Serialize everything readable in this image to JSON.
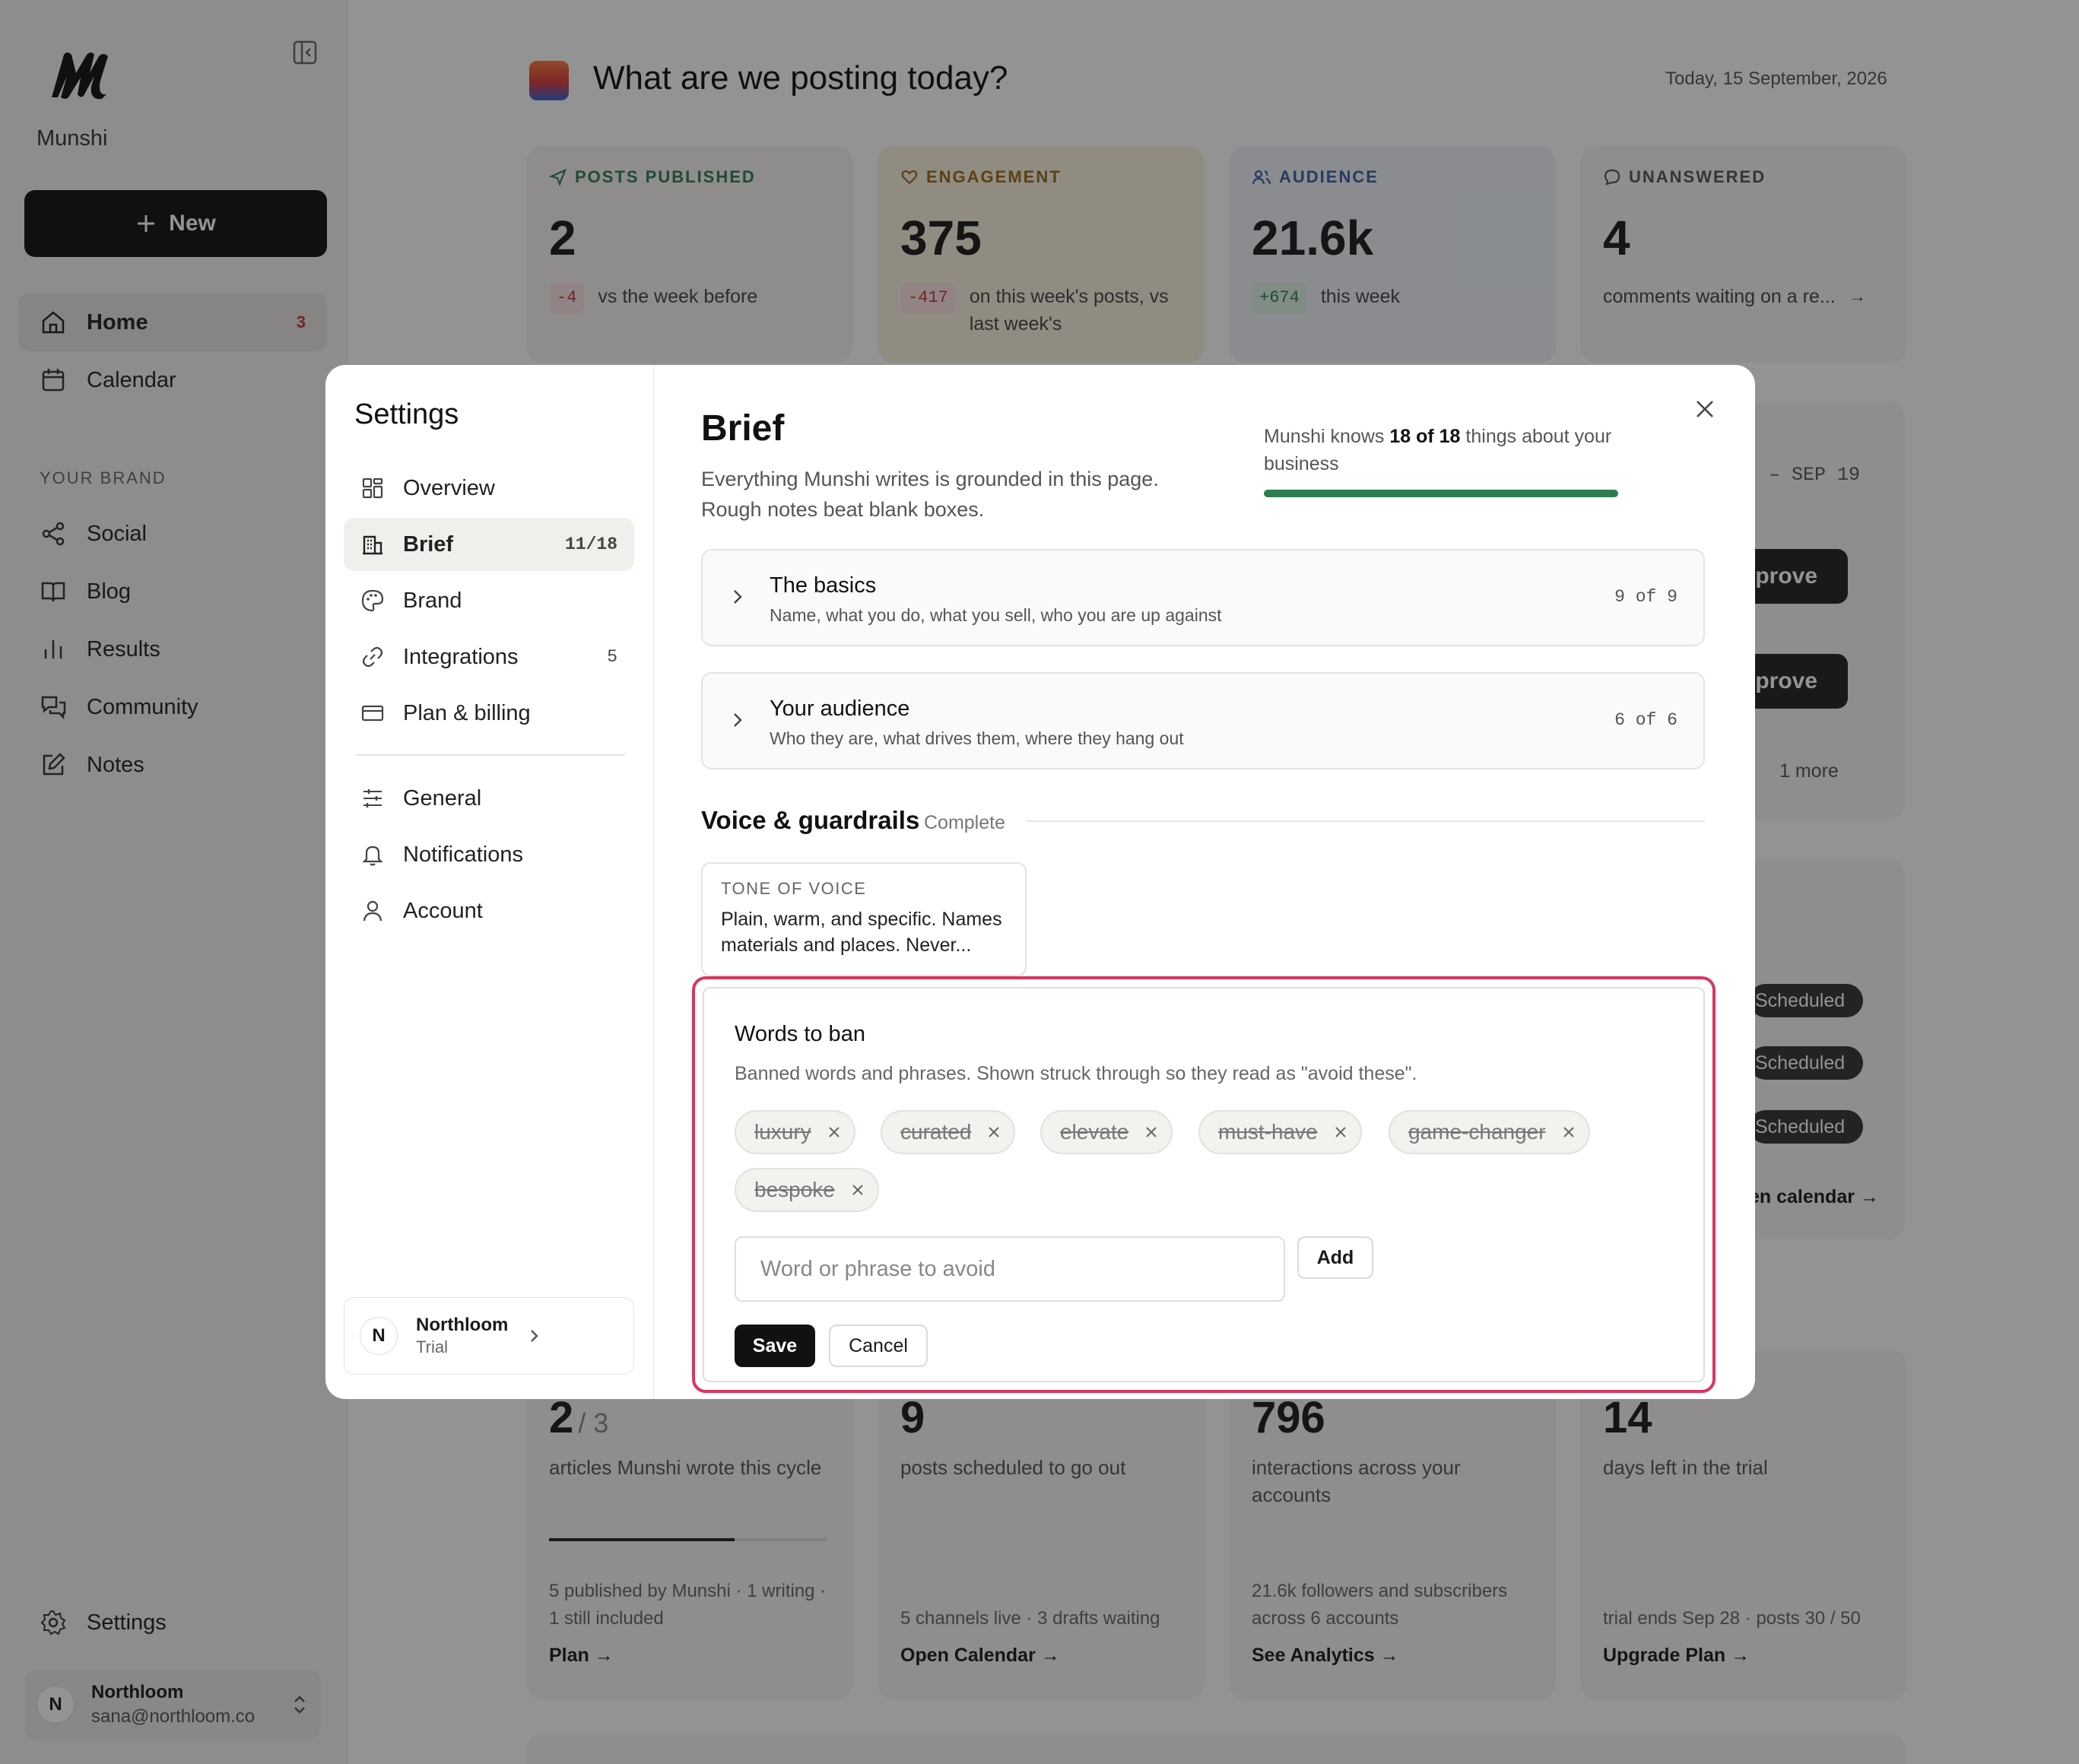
{
  "sidebar": {
    "brand": "Munshi",
    "new_label": "New",
    "items": [
      {
        "label": "Home",
        "count": "3"
      },
      {
        "label": "Calendar"
      }
    ],
    "section_label": "YOUR BRAND",
    "brand_items": [
      {
        "label": "Social"
      },
      {
        "label": "Blog"
      },
      {
        "label": "Results"
      },
      {
        "label": "Community"
      },
      {
        "label": "Notes"
      }
    ],
    "settings_label": "Settings",
    "user": {
      "initial": "N",
      "name": "Northloom",
      "email": "sana@northloom.co"
    }
  },
  "header": {
    "title": "What are we posting today?",
    "date": "Today, 15 September, 2026"
  },
  "stats": [
    {
      "label": "POSTS PUBLISHED",
      "value": "2",
      "delta": "-4",
      "note": "vs the week before",
      "color": "#2f7d4f"
    },
    {
      "label": "ENGAGEMENT",
      "value": "375",
      "delta": "-417",
      "note": "on this week's posts, vs last week's",
      "color": "#9a6a16"
    },
    {
      "label": "AUDIENCE",
      "value": "21.6k",
      "delta": "+674",
      "note": "this week",
      "color": "#3a5f9e"
    },
    {
      "label": "UNANSWERED",
      "value": "4",
      "note": "comments waiting on a re...",
      "color": "#555555"
    }
  ],
  "right_panel": {
    "date_range": "– SEP 19",
    "approve_label": "pprove",
    "more": "1 more",
    "scheduled_label": "Scheduled",
    "calendar_link": "en calendar →"
  },
  "bottom_cards": [
    {
      "value": "2",
      "value_suffix": "/ 3",
      "sub": "articles Munshi wrote this cycle",
      "progress": 0.667,
      "foot": "5 published by Munshi · 1 writing · 1 still included",
      "link": "Plan →"
    },
    {
      "value": "9",
      "sub": "posts scheduled to go out",
      "foot": "5 channels live · 3 drafts waiting",
      "link": "Open Calendar →"
    },
    {
      "value": "796",
      "sub": "interactions across your accounts",
      "foot": "21.6k followers and subscribers across 6 accounts",
      "link": "See Analytics →"
    },
    {
      "value": "14",
      "sub": "days left in the trial",
      "foot": "trial ends Sep 28 · posts 30 / 50",
      "link": "Upgrade Plan →"
    }
  ],
  "modal": {
    "title": "Settings",
    "nav": [
      {
        "label": "Overview"
      },
      {
        "label": "Brief",
        "count": "11/18"
      },
      {
        "label": "Brand"
      },
      {
        "label": "Integrations",
        "count": "5"
      },
      {
        "label": "Plan & billing"
      },
      {
        "label": "General"
      },
      {
        "label": "Notifications"
      },
      {
        "label": "Account"
      }
    ],
    "org": {
      "initial": "N",
      "name": "Northloom",
      "plan": "Trial"
    },
    "brief": {
      "title": "Brief",
      "description": "Everything Munshi writes is grounded in this page. Rough notes beat blank boxes.",
      "knows_prefix": "Munshi knows",
      "knows_count": "18 of 18",
      "knows_suffix": "things about your business",
      "knows_progress": 1.0
    },
    "sections": [
      {
        "title": "The basics",
        "description": "Name, what you do, what you sell, who you are up against",
        "count": "9 of 9"
      },
      {
        "title": "Your audience",
        "description": "Who they are, what drives them, where they hang out",
        "count": "6 of 6"
      }
    ],
    "voice": {
      "title": "Voice & guardrails",
      "status": "Complete",
      "tone_label": "TONE OF VOICE",
      "tone_value": "Plain, warm, and specific. Names materials and places. Never..."
    },
    "ban": {
      "title": "Words to ban",
      "description": "Banned words and phrases. Shown struck through so they read as \"avoid these\".",
      "words": [
        "luxury",
        "curated",
        "elevate",
        "must-have",
        "game-changer",
        "bespoke"
      ],
      "placeholder": "Word or phrase to avoid",
      "add_label": "Add",
      "save_label": "Save",
      "cancel_label": "Cancel"
    }
  }
}
